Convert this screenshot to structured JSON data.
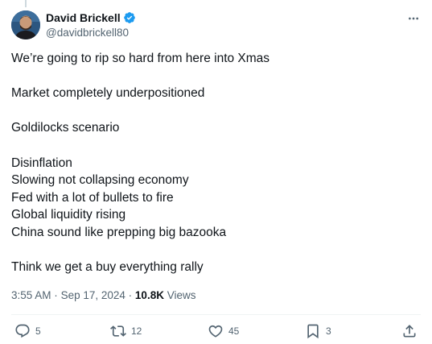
{
  "author": {
    "display_name": "David Brickell",
    "handle": "@davidbrickell80",
    "verified": true,
    "verified_color": "#1d9bf0"
  },
  "tweet": {
    "lines": [
      "We’re going to rip so hard from here into Xmas",
      "",
      "Market completely underpositioned",
      "",
      "Goldilocks scenario",
      "",
      "Disinflation",
      "Slowing not collapsing economy",
      "Fed with a lot of bullets to fire",
      "Global liquidity rising",
      "China sound like prepping big bazooka",
      "",
      "Think we get a buy everything rally"
    ]
  },
  "meta": {
    "time": "3:55 AM",
    "separator": "·",
    "date": "Sep 17, 2024",
    "views_count": "10.8K",
    "views_label": "Views"
  },
  "actions": {
    "replies": "5",
    "reposts": "12",
    "likes": "45",
    "bookmarks": "3"
  },
  "icons": {
    "more": "more-dots-icon",
    "reply": "reply-icon",
    "repost": "repost-icon",
    "like": "heart-icon",
    "bookmark": "bookmark-icon",
    "share": "share-icon"
  }
}
